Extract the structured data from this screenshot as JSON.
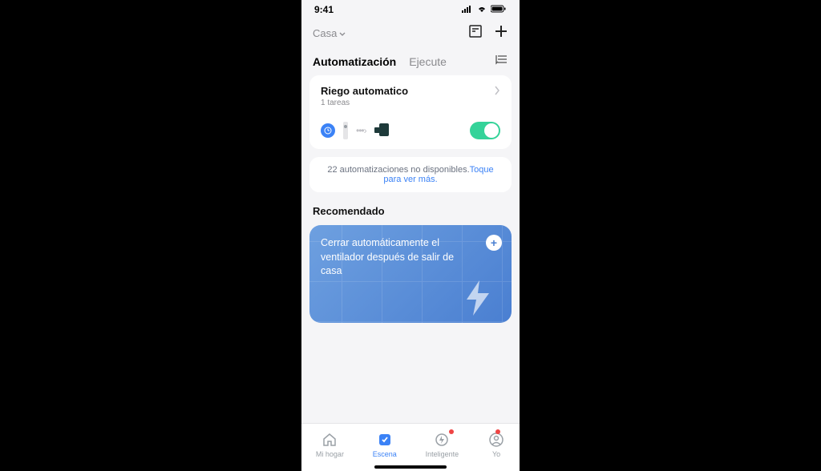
{
  "statusBar": {
    "time": "9:41"
  },
  "header": {
    "homeName": "Casa"
  },
  "tabs": {
    "automation": "Automatización",
    "tapToRun": "Ejecute"
  },
  "automationCard": {
    "title": "Riego automatico",
    "subtitle": "1 tareas"
  },
  "infoCard": {
    "text": "22 automatizaciones no disponibles.",
    "link": "Toque para ver más."
  },
  "recommended": {
    "sectionTitle": "Recomendado",
    "item1": "Cerrar automáticamente el ventilador después de salir de casa"
  },
  "tabbar": {
    "home": "Mi hogar",
    "scene": "Escena",
    "smart": "Inteligente",
    "me": "Yo"
  }
}
